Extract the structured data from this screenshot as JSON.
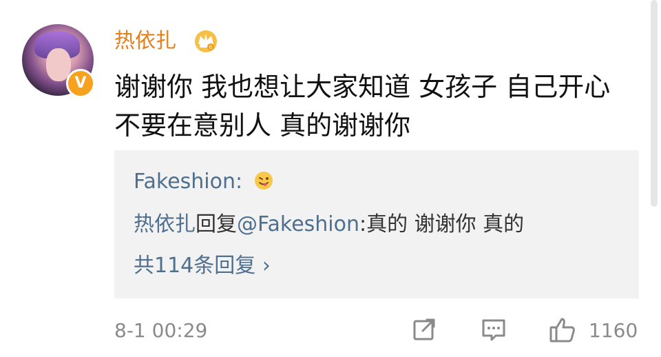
{
  "comment": {
    "username": "热依扎",
    "text_line1": "谢谢你 我也想让大家知道 女孩子 自己开心",
    "text_line2": "不要在意别人 真的谢谢你",
    "timestamp": "8-1 00:29",
    "like_count": "1160",
    "verified_badge": "V",
    "icons": {
      "crown": "crown-badge-icon",
      "share": "share-icon",
      "comment": "comment-icon",
      "like": "thumbs-up-icon"
    }
  },
  "reply": {
    "first_author": "Fakeshion",
    "first_separator": ":",
    "second_author": "热依扎",
    "second_action": "回复",
    "second_target": "@Fakeshion",
    "second_text": ":真的 谢谢你 真的",
    "more_replies": "共114条回复",
    "chevron": "›"
  },
  "colors": {
    "username": "#e77d1b",
    "link": "#4f6f8f",
    "meta": "#8a8a8a",
    "reply_bg": "#f2f2f2"
  }
}
